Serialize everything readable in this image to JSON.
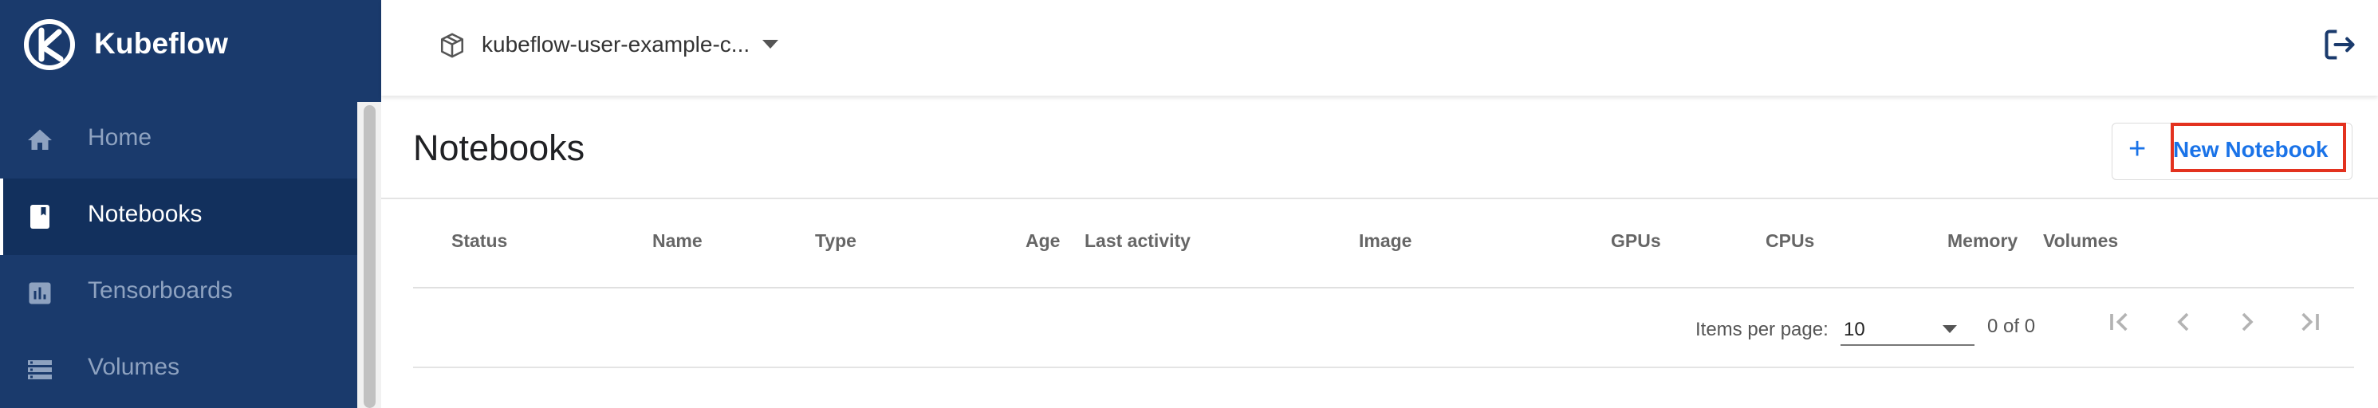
{
  "app": {
    "name": "Kubeflow"
  },
  "sidebar": {
    "items": [
      {
        "label": "Home",
        "icon": "home-icon"
      },
      {
        "label": "Notebooks",
        "icon": "notebook-icon",
        "active": true
      },
      {
        "label": "Tensorboards",
        "icon": "chart-icon"
      },
      {
        "label": "Volumes",
        "icon": "storage-icon"
      }
    ]
  },
  "topbar": {
    "namespace": "kubeflow-user-example-c...",
    "namespace_icon": "package-icon",
    "logout_icon": "logout-icon"
  },
  "page": {
    "title": "Notebooks"
  },
  "actions": {
    "new_notebook_label": "New Notebook",
    "new_notebook_icon": "plus-icon"
  },
  "table": {
    "columns": [
      "Status",
      "Name",
      "Type",
      "Age",
      "Last activity",
      "Image",
      "GPUs",
      "CPUs",
      "Memory",
      "Volumes"
    ],
    "rows": []
  },
  "paginator": {
    "items_per_page_label": "Items per page:",
    "items_per_page_value": "10",
    "range_label": "0 of 0"
  },
  "colors": {
    "sidebar": "#1a3a6c",
    "accent": "#1a73e8",
    "highlight": "#e3321f"
  }
}
